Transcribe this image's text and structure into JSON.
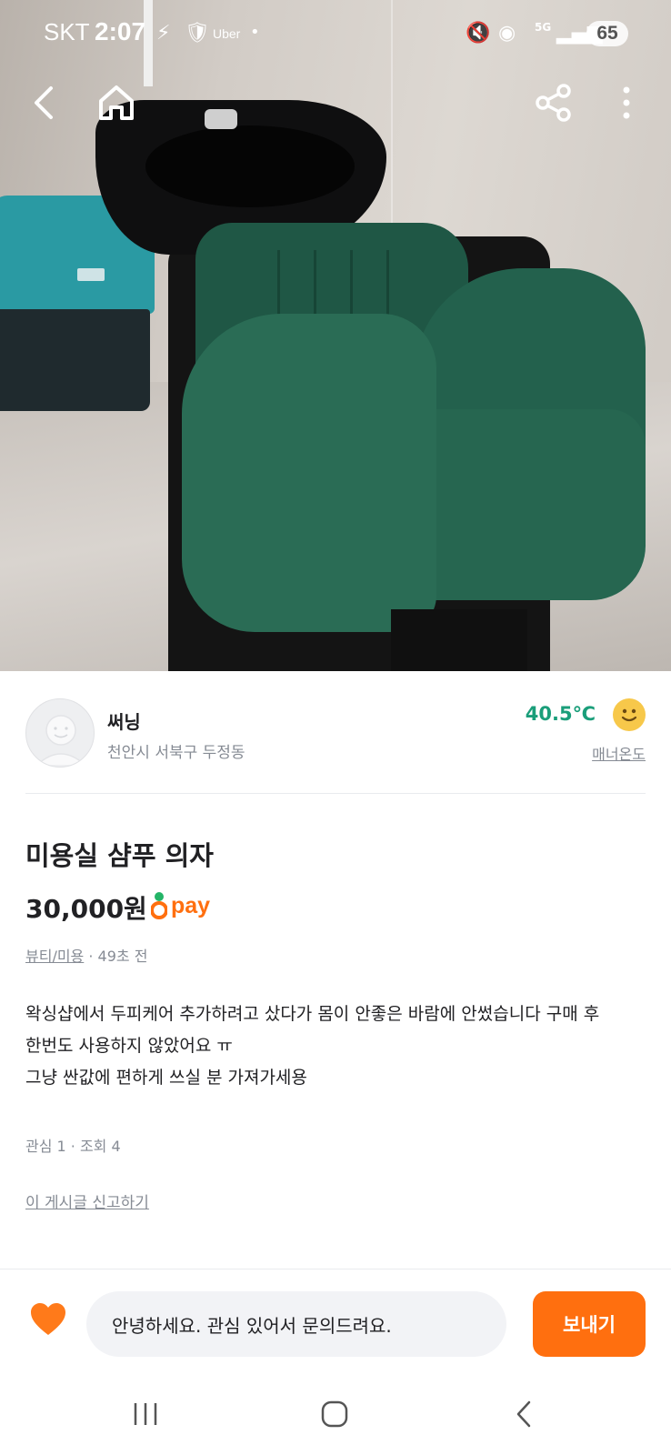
{
  "status_bar": {
    "carrier": "SKT",
    "time": "2:07",
    "uber_label": "Uber",
    "network": "5G",
    "battery": "65"
  },
  "photo_overlay": {
    "back_icon": "chevron-left-icon",
    "home_icon": "home-icon",
    "share_icon": "share-icon",
    "more_icon": "more-vertical-icon"
  },
  "seller": {
    "name": "써닝",
    "location": "천안시 서북구 두정동",
    "temperature": "40.5℃",
    "temperature_label": "매너온도",
    "temperature_color": "#1a9e7a"
  },
  "listing": {
    "title": "미용실 샴푸 의자",
    "price": "30,000원",
    "pay_label": "pay",
    "category": "뷰티/미용",
    "time_ago": " · 49초 전",
    "description": [
      "왁싱샵에서 두피케어 추가하려고 샀다가 몸이 안좋은 바람에 안썼습니다 구매 후",
      "한번도 사용하지 않았어요 ㅠ",
      "그냥 싼값에 편하게 쓰실 분 가져가세용"
    ],
    "stats": "관심 1 · 조회 4",
    "report_link": "이 게시글 신고하기"
  },
  "chat": {
    "input_value": "안녕하세요. 관심 있어서 문의드려요.",
    "send_label": "보내기",
    "accent_color": "#ff6f0f"
  },
  "navigation": {
    "recents_icon": "recents-icon",
    "home_icon": "home-circle-icon",
    "back_icon": "back-icon"
  }
}
